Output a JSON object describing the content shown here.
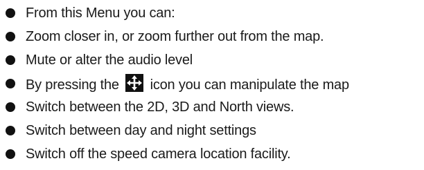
{
  "items": [
    {
      "text": "From this Menu you can:"
    },
    {
      "text": "Zoom closer in, or zoom further out from the map."
    },
    {
      "text": "Mute or alter the audio level"
    },
    {
      "before": "By pressing the",
      "icon": "move-arrows-icon",
      "after": "icon you can manipulate the map"
    },
    {
      "text": "Switch between the 2D, 3D and North views."
    },
    {
      "text": "Switch between day and night settings"
    },
    {
      "text": "Switch off the speed camera location facility."
    }
  ]
}
